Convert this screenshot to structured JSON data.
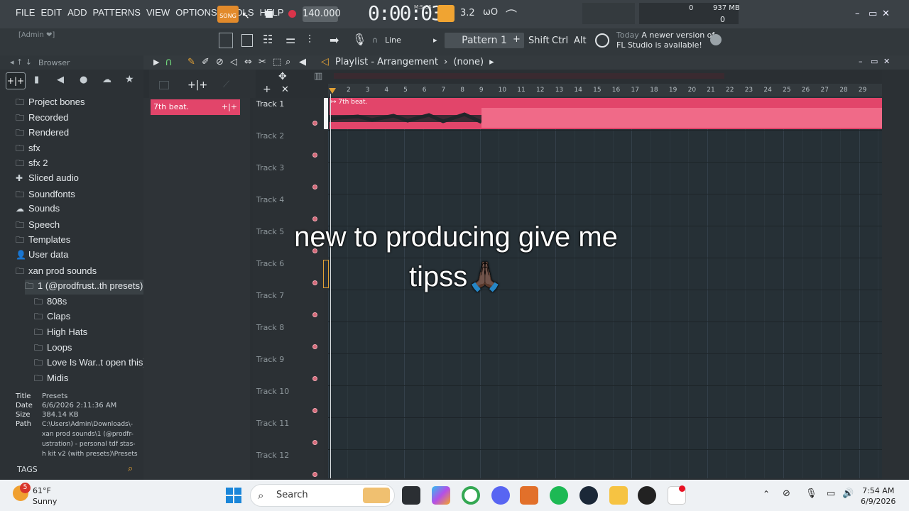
{
  "menu": [
    "FILE",
    "EDIT",
    "ADD",
    "PATTERNS",
    "VIEW",
    "OPTIONS",
    "TOOLS",
    "HELP"
  ],
  "song_label": "SONG",
  "tempo": "140.000",
  "time": "0:00:03",
  "time_label": "M:S:CS",
  "cpu": "0",
  "memory": "937 MB",
  "poly": "0",
  "hint": "[Admin ❤]",
  "snap": "Line",
  "pattern": "Pattern 1",
  "keys": [
    "Shift",
    "Ctrl",
    "Alt"
  ],
  "news": {
    "date": "Today",
    "line1": "A newer version of",
    "line2": "FL Studio is available!"
  },
  "browser": {
    "title": "Browser",
    "items": [
      {
        "label": "Project bones",
        "icon": "folder-icon",
        "indent": 0
      },
      {
        "label": "Recorded",
        "icon": "folder-icon",
        "indent": 0
      },
      {
        "label": "Rendered",
        "icon": "folder-icon",
        "indent": 0
      },
      {
        "label": "sfx",
        "icon": "folder-icon",
        "indent": 0
      },
      {
        "label": "sfx 2",
        "icon": "folder-icon",
        "indent": 0
      },
      {
        "label": "Sliced audio",
        "icon": "plugin-icon",
        "indent": 0
      },
      {
        "label": "Soundfonts",
        "icon": "folder-icon",
        "indent": 0
      },
      {
        "label": "Sounds",
        "icon": "cloud-icon",
        "indent": 0
      },
      {
        "label": "Speech",
        "icon": "folder-icon",
        "indent": 0
      },
      {
        "label": "Templates",
        "icon": "folder-icon",
        "indent": 0
      },
      {
        "label": "User data",
        "icon": "user-icon",
        "indent": 0
      },
      {
        "label": "xan prod sounds",
        "icon": "folder-icon",
        "indent": 0
      },
      {
        "label": "1 (@prodfrust..th presets)",
        "icon": "folder-icon",
        "indent": 1
      },
      {
        "label": "808s",
        "icon": "folder-icon",
        "indent": 2
      },
      {
        "label": "Claps",
        "icon": "folder-icon",
        "indent": 2
      },
      {
        "label": "High Hats",
        "icon": "folder-icon",
        "indent": 2
      },
      {
        "label": "Loops",
        "icon": "folder-icon",
        "indent": 2
      },
      {
        "label": "Love Is War..t open this)",
        "icon": "folder-icon",
        "indent": 2
      },
      {
        "label": "Midis",
        "icon": "folder-icon",
        "indent": 2
      }
    ],
    "info": {
      "title_label": "Title",
      "title": "Presets",
      "date_label": "Date",
      "date": "6/6/2026 2:11:36 AM",
      "size_label": "Size",
      "size": "384.14 KB",
      "path_label": "Path",
      "path_lines": [
        "C:\\Users\\Admin\\Downloads\\-",
        "xan prod sounds\\1 (@prodfr-",
        "ustration) - personal tdf stas-",
        "h kit v2 (with presets)\\Presets"
      ]
    },
    "tags": "TAGS"
  },
  "playlist": {
    "title": "Playlist - Arrangement",
    "sep": "›",
    "pattern_sel": "(none)",
    "pattern_item": "7th beat.",
    "clip_label": "7th beat.",
    "ruler": [
      "2",
      "3",
      "4",
      "5",
      "6",
      "7",
      "8",
      "9",
      "10",
      "11",
      "12",
      "13",
      "14",
      "15",
      "16",
      "17",
      "18",
      "19",
      "20",
      "21",
      "22",
      "23",
      "24",
      "25",
      "26",
      "27",
      "28",
      "29"
    ],
    "tracks": [
      "Track 1",
      "Track 2",
      "Track 3",
      "Track 4",
      "Track 5",
      "Track 6",
      "Track 7",
      "Track 8",
      "Track 9",
      "Track 10",
      "Track 11",
      "Track 12"
    ]
  },
  "caption_line1": "new to producing give me",
  "caption_line2": "tipss🙏🏿",
  "taskbar": {
    "weather_temp": "61°F",
    "weather_desc": "Sunny",
    "weather_badge": "5",
    "search": "Search",
    "time": "7:54 AM",
    "date": "6/9/2026"
  },
  "colors": {
    "accent": "#e2456a",
    "song_btn": "#e28a2b",
    "bg": "#263036"
  }
}
